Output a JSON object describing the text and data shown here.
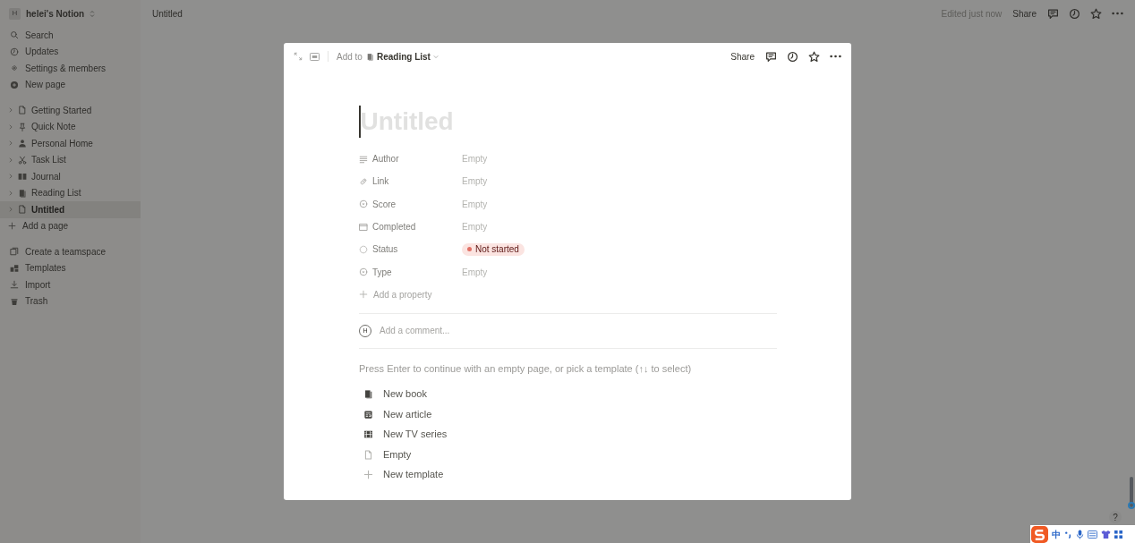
{
  "sidebar": {
    "workspace": {
      "initial": "H",
      "name": "helei's Notion"
    },
    "actions": [
      {
        "label": "Search"
      },
      {
        "label": "Updates"
      },
      {
        "label": "Settings & members"
      },
      {
        "label": "New page"
      }
    ],
    "pages": [
      {
        "label": "Getting Started",
        "selected": false
      },
      {
        "label": "Quick Note",
        "selected": false
      },
      {
        "label": "Personal Home",
        "selected": false
      },
      {
        "label": "Task List",
        "selected": false
      },
      {
        "label": "Journal",
        "selected": false
      },
      {
        "label": "Reading List",
        "selected": false
      },
      {
        "label": "Untitled",
        "selected": true
      }
    ],
    "add_page": "Add a page",
    "footer": [
      {
        "label": "Create a teamspace"
      },
      {
        "label": "Templates"
      },
      {
        "label": "Import"
      },
      {
        "label": "Trash"
      }
    ]
  },
  "topbar": {
    "breadcrumb": "Untitled",
    "edited": "Edited just now",
    "share": "Share"
  },
  "modal": {
    "add_to": "Add to",
    "database": "Reading List",
    "share": "Share",
    "title_placeholder": "Untitled",
    "properties": [
      {
        "name": "Author",
        "kind": "empty",
        "value": "Empty"
      },
      {
        "name": "Link",
        "kind": "empty",
        "value": "Empty"
      },
      {
        "name": "Score",
        "kind": "empty",
        "value": "Empty"
      },
      {
        "name": "Completed",
        "kind": "empty",
        "value": "Empty"
      },
      {
        "name": "Status",
        "kind": "status",
        "value": "Not started",
        "color": "#e16f64"
      },
      {
        "name": "Type",
        "kind": "empty",
        "value": "Empty"
      }
    ],
    "add_property": "Add a property",
    "comment": {
      "avatar": "H",
      "placeholder": "Add a comment..."
    },
    "hint": "Press Enter to continue with an empty page, or pick a template (↑↓ to select)",
    "templates": [
      {
        "label": "New book"
      },
      {
        "label": "New article"
      },
      {
        "label": "New TV series"
      },
      {
        "label": "Empty"
      },
      {
        "label": "New template"
      }
    ]
  },
  "help": "?",
  "ime_toolbar": {
    "mode": "中"
  }
}
